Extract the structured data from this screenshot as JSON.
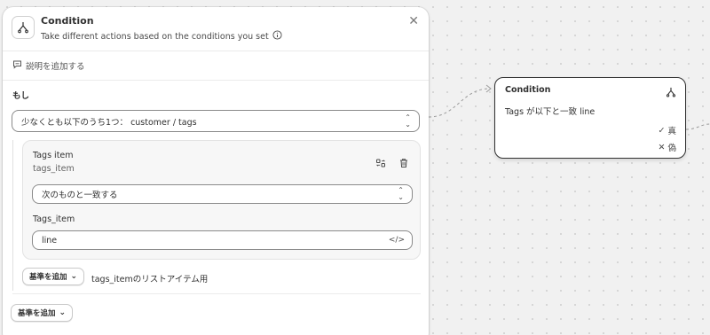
{
  "panel": {
    "title": "Condition",
    "subtitle": "Take different actions based on the conditions you set",
    "add_description": "説明を追加する",
    "if_label": "もし",
    "condition_select": "少なくとも以下のうち1つ： customer / tags",
    "tags_item": {
      "title": "Tags item",
      "subtitle": "tags_item",
      "operator": "次のものと一致する",
      "field_label": "Tags_item",
      "value": "line"
    },
    "add_criteria_inner": "基準を追加",
    "inline_note": "tags_itemのリストアイテム用",
    "add_criteria_outer": "基準を追加"
  },
  "node": {
    "title": "Condition",
    "summary": "Tags が以下と一致 line",
    "true_label": "真",
    "false_label": "偽"
  }
}
